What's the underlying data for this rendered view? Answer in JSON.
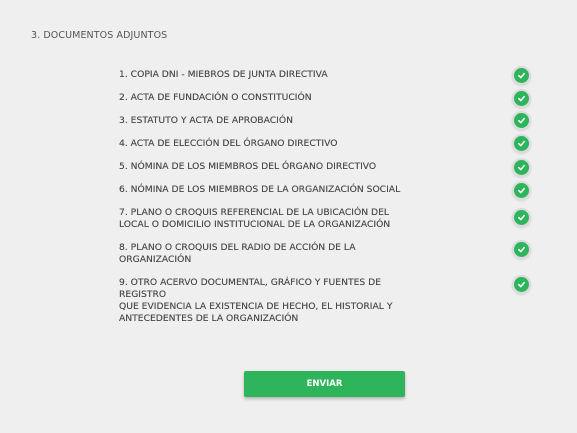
{
  "section": {
    "title": "3. DOCUMENTOS ADJUNTOS"
  },
  "documents": [
    {
      "label": "1. COPIA DNI - MIEBROS DE JUNTA DIRECTIVA",
      "status": "check-circle-icon",
      "attached": true
    },
    {
      "label": "2. ACTA DE FUNDACIÓN O CONSTITUCIÓN",
      "status": "check-circle-icon",
      "attached": true
    },
    {
      "label": "3. ESTATUTO Y ACTA DE APROBACIÓN",
      "status": "check-circle-icon",
      "attached": true
    },
    {
      "label": "4. ACTA DE ELECCIÓN DEL ÓRGANO DIRECTIVO",
      "status": "check-circle-icon",
      "attached": true
    },
    {
      "label": "5. NÓMINA DE LOS MIEMBROS DEL ÓRGANO DIRECTIVO",
      "status": "check-circle-icon",
      "attached": true
    },
    {
      "label": "6. NÓMINA DE LOS MIEMBROS DE LA ORGANIZACIÓN SOCIAL",
      "status": "check-circle-icon",
      "attached": true
    },
    {
      "label": "7. PLANO O CROQUIS REFERENCIAL DE LA UBICACIÓN  DEL\nLOCAL O DOMICILIO INSTITUCIONAL DE LA ORGANIZACIÓN",
      "status": "check-circle-icon",
      "attached": true
    },
    {
      "label": "8. PLANO O CROQUIS DEL RADIO DE ACCIÓN DE LA\nORGANIZACIÓN",
      "status": "check-circle-icon",
      "attached": true
    },
    {
      "label": "9. OTRO ACERVO DOCUMENTAL, GRÁFICO Y FUENTES DE REGISTRO\nQUE EVIDENCIA LA EXISTENCIA DE HECHO, EL HISTORIAL Y\nANTECEDENTES DE LA ORGANIZACIÓN",
      "status": "check-circle-icon",
      "attached": true
    }
  ],
  "actions": {
    "submit_label": "ENVIAR"
  },
  "colors": {
    "background": "#efefef",
    "accent": "#2eb55b",
    "text": "#4a4a4a"
  }
}
